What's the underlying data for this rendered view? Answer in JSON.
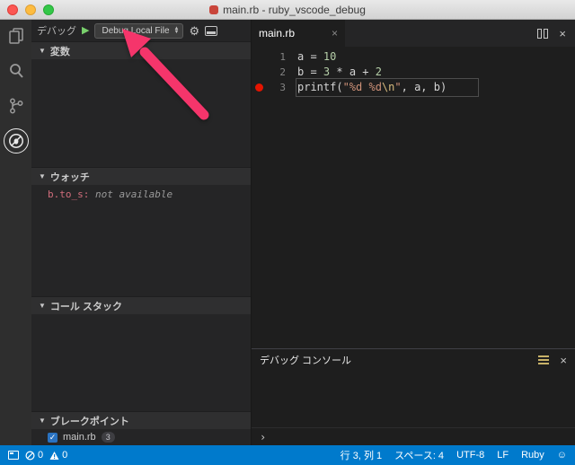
{
  "window": {
    "title": "main.rb - ruby_vscode_debug"
  },
  "activity_bar": {
    "items": [
      {
        "id": "explorer"
      },
      {
        "id": "search"
      },
      {
        "id": "source-control"
      },
      {
        "id": "debug",
        "active": true
      }
    ]
  },
  "sidebar": {
    "title": "デバッグ",
    "launch_config": "Debug Local File",
    "sections": {
      "variables": {
        "label": "変数"
      },
      "watch": {
        "label": "ウォッチ",
        "item_expr": "b.to_s:",
        "item_value": " not available"
      },
      "callstack": {
        "label": "コール スタック"
      },
      "breakpoints": {
        "label": "ブレークポイント",
        "file": "main.rb",
        "line_badge": "3"
      }
    }
  },
  "editor": {
    "tab": {
      "label": "main.rb"
    },
    "lines": [
      {
        "num": "1",
        "breakpoint": false,
        "current": false,
        "tokens": [
          {
            "t": "a = ",
            "c": "plain"
          },
          {
            "t": "10",
            "c": "num"
          }
        ]
      },
      {
        "num": "2",
        "breakpoint": false,
        "current": false,
        "tokens": [
          {
            "t": "b = ",
            "c": "plain"
          },
          {
            "t": "3",
            "c": "num"
          },
          {
            "t": " * a + ",
            "c": "plain"
          },
          {
            "t": "2",
            "c": "num"
          }
        ]
      },
      {
        "num": "3",
        "breakpoint": true,
        "current": true,
        "tokens": [
          {
            "t": "printf(",
            "c": "plain"
          },
          {
            "t": "\"%d %d",
            "c": "str"
          },
          {
            "t": "\\n",
            "c": "esc"
          },
          {
            "t": "\"",
            "c": "str"
          },
          {
            "t": ", a, b)",
            "c": "plain"
          }
        ]
      }
    ]
  },
  "panel": {
    "title": "デバッグ コンソール",
    "prompt": "›"
  },
  "status_bar": {
    "error_count": "0",
    "warning_count": "0",
    "cursor": "行 3, 列 1",
    "indent": "スペース: 4",
    "encoding": "UTF-8",
    "eol": "LF",
    "language": "Ruby",
    "feedback": "☺"
  },
  "colors": {
    "statusbar": "#007acc",
    "breakpoint": "#e51400",
    "annotation_arrow": "#f5356b",
    "play_button": "#79d06c"
  }
}
